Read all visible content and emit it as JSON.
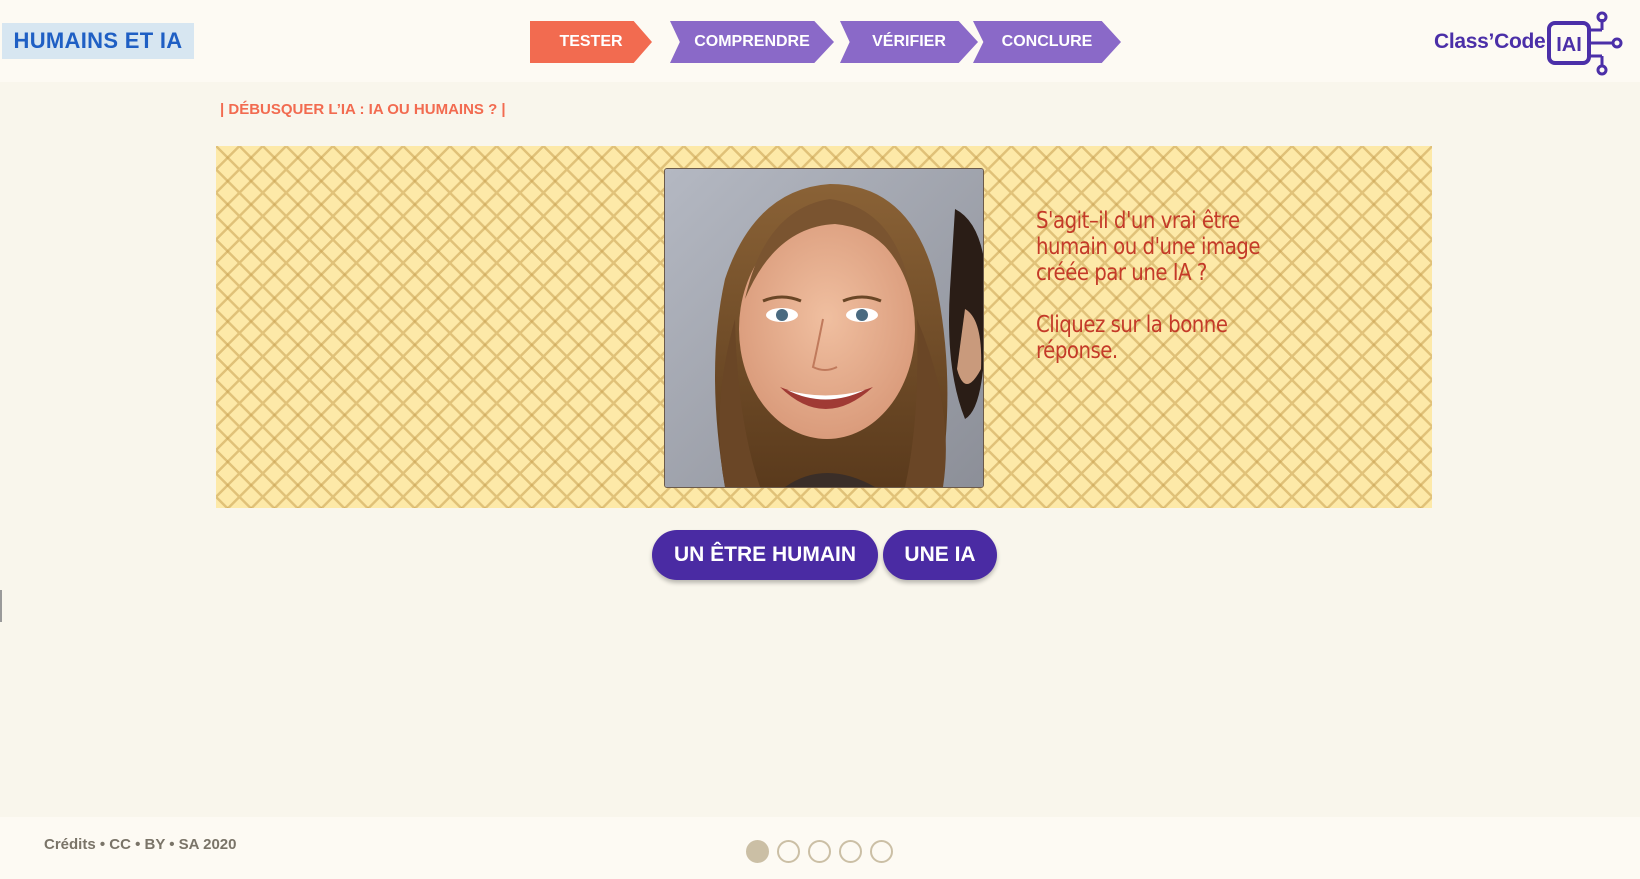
{
  "app_title": "HUMAINS ET IA",
  "steps": [
    {
      "label": "TESTER",
      "active": true
    },
    {
      "label": "COMPRENDRE",
      "active": false
    },
    {
      "label": "VÉRIFIER",
      "active": false
    },
    {
      "label": "CONCLURE",
      "active": false
    }
  ],
  "logo": {
    "text": "Class’Code",
    "mark": "IAI"
  },
  "breadcrumb": "| DÉBUSQUER L’IA : IA OU HUMAINS ? |",
  "question": {
    "line1": "S'agit–il d'un vrai être humain ou d'une image créée par une IA ?",
    "instruction": "Cliquez sur la bonne réponse."
  },
  "answers": {
    "human": "UN ÊTRE HUMAIN",
    "ia": "UNE IA"
  },
  "footer": {
    "credits": "Crédits • CC • BY • SA 2020"
  },
  "pagination": {
    "total": 5,
    "current": 1
  },
  "colors": {
    "accent_orange": "#f26b50",
    "accent_purple": "#4a2ba3",
    "step_purple": "#8a69c8",
    "stage_yellow": "#fde9a8",
    "prompt_red": "#c43a28"
  }
}
